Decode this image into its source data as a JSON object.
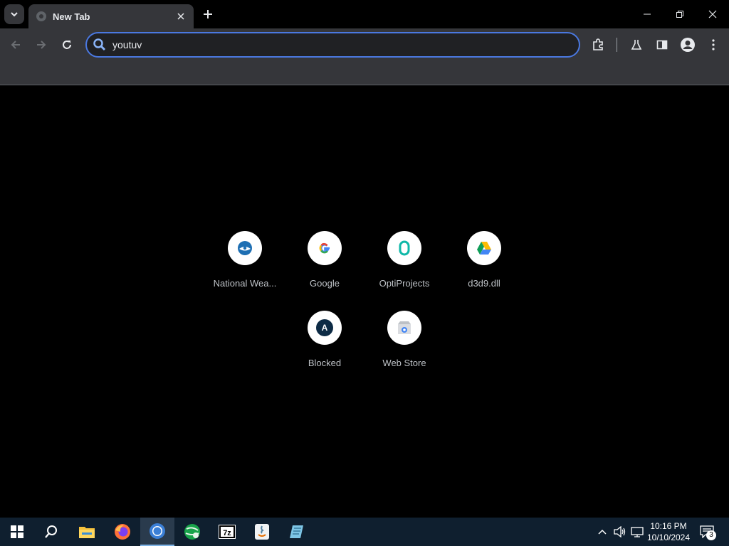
{
  "browser": {
    "tab": {
      "title": "New Tab"
    },
    "omnibox": {
      "value": "youtuv"
    }
  },
  "shortcuts": [
    {
      "label": "National Wea..."
    },
    {
      "label": "Google"
    },
    {
      "label": "OptiProjects"
    },
    {
      "label": "d3d9.dll"
    },
    {
      "label": "Blocked",
      "letter": "A"
    },
    {
      "label": "Web Store"
    }
  ],
  "taskbar": {
    "time": "10:16 PM",
    "date": "10/10/2024",
    "notification_count": "3",
    "sevenzip_label": "7z"
  },
  "colors": {
    "accent": "#4a78e0",
    "toolbar": "#35363a",
    "background": "#000000"
  }
}
